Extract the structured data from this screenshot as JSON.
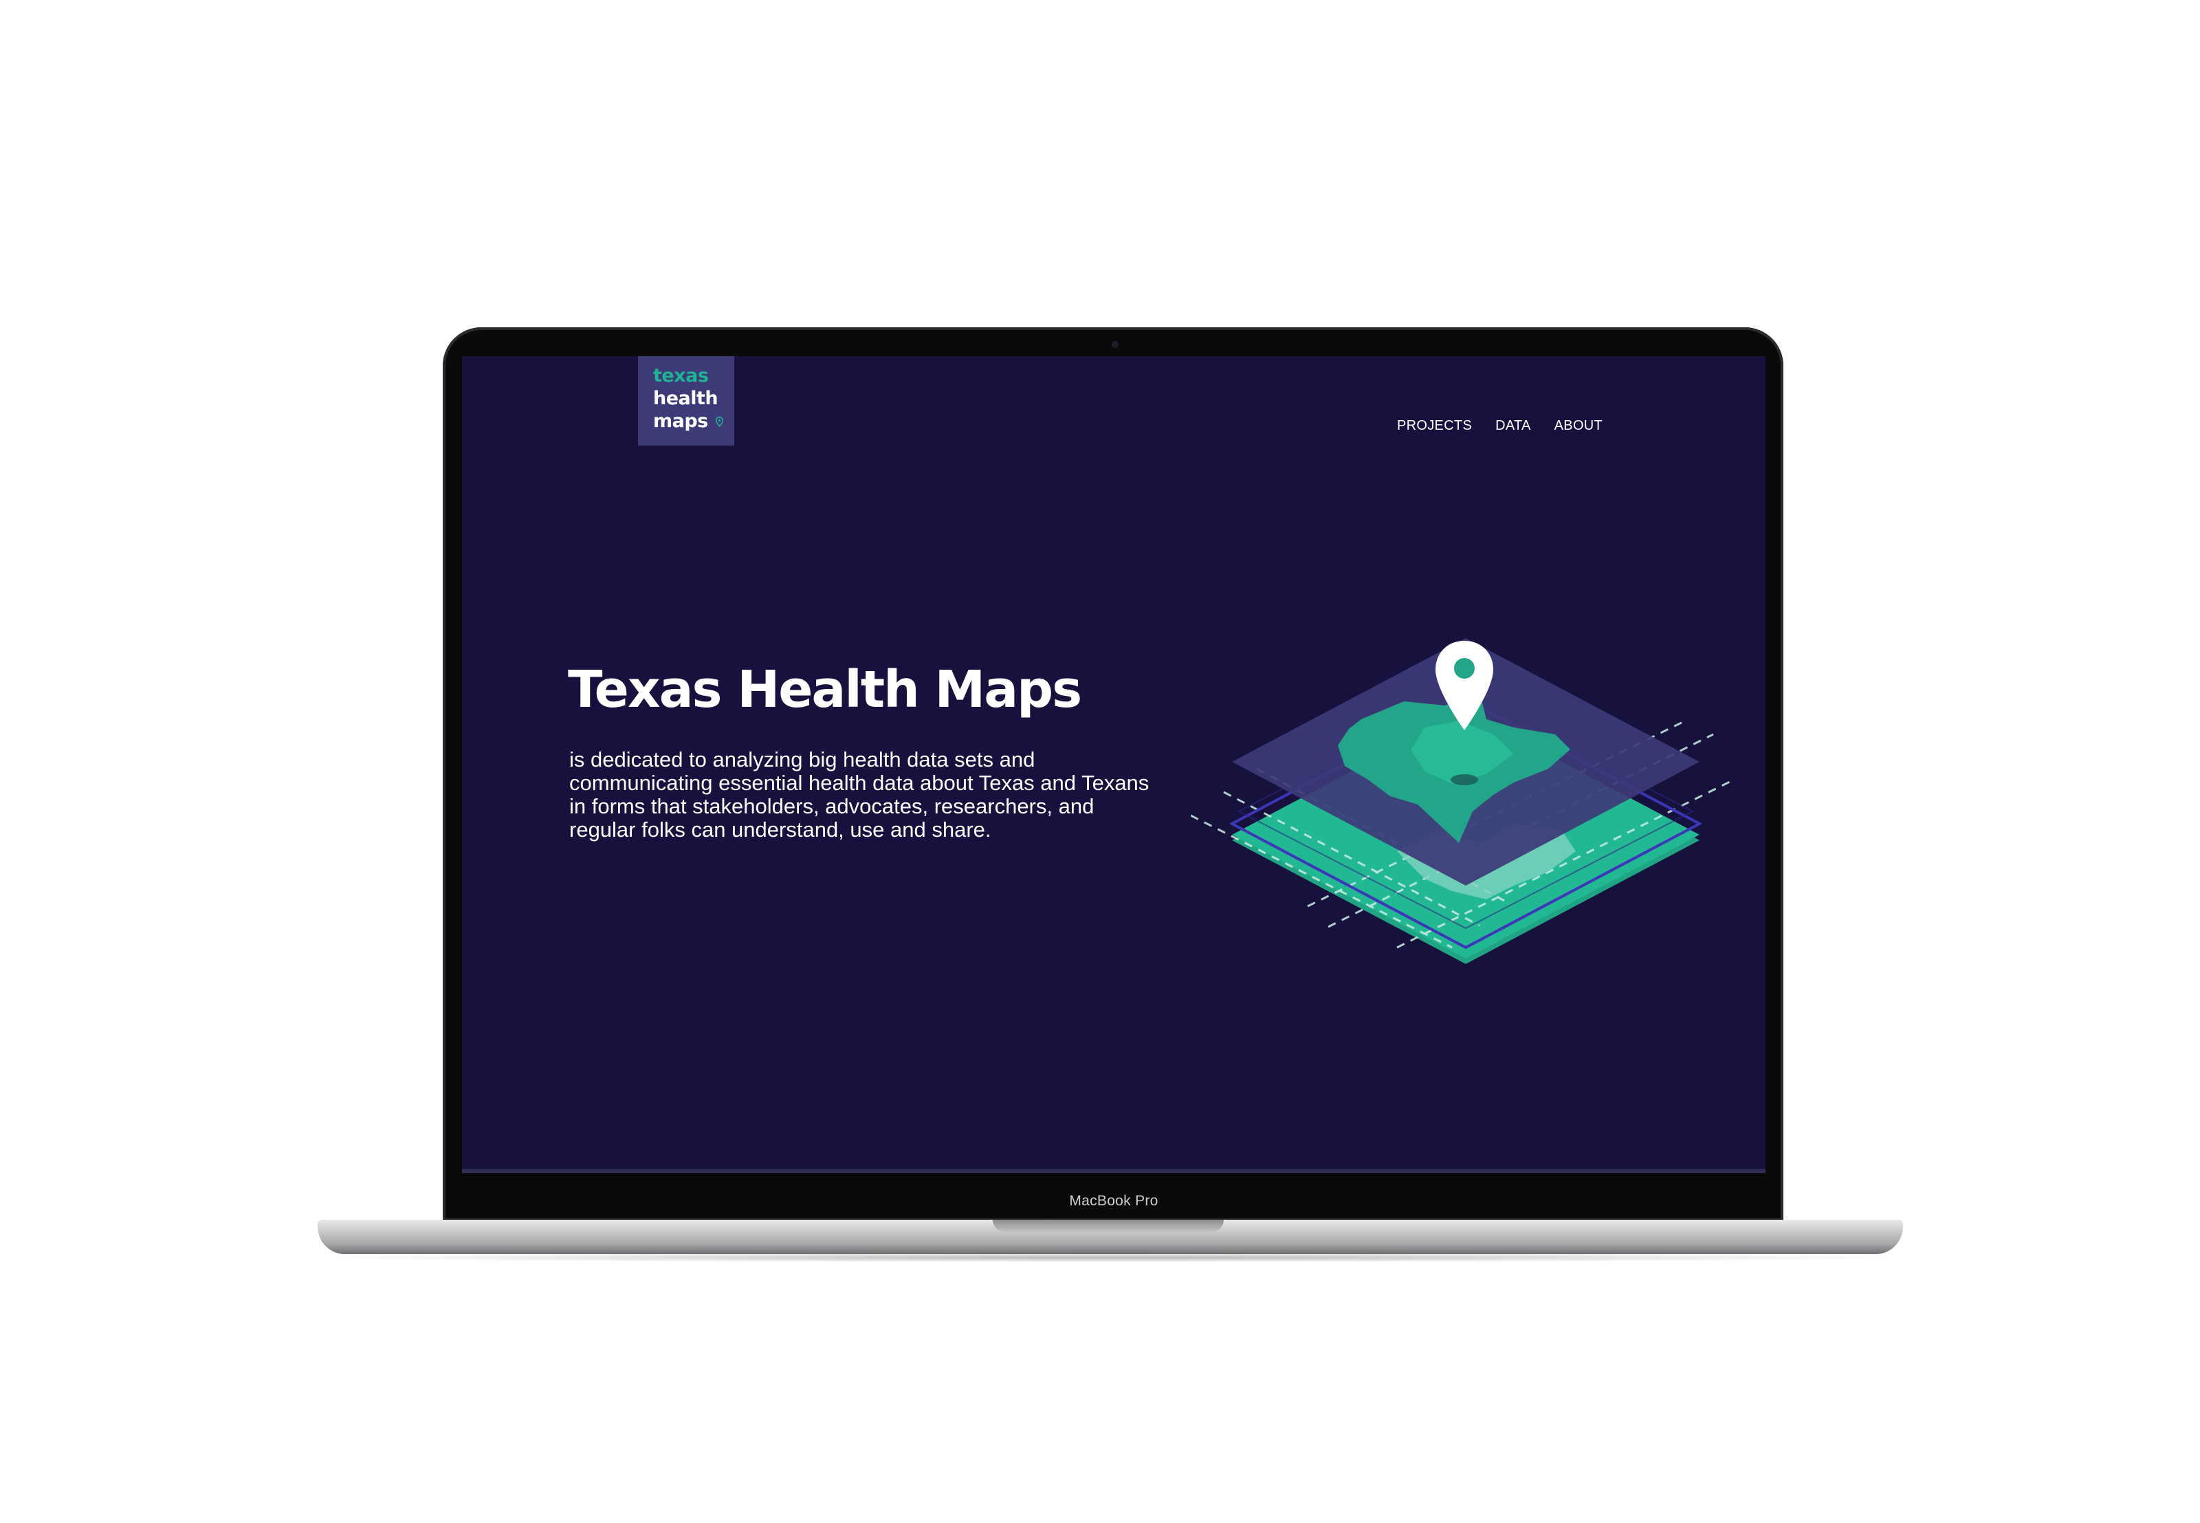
{
  "device": {
    "label": "MacBook Pro"
  },
  "site": {
    "logo": {
      "line1": "texas",
      "line2": "health",
      "line3": "maps",
      "icon": "map-pin-icon"
    },
    "nav": {
      "items": [
        "PROJECTS",
        "DATA",
        "ABOUT"
      ]
    },
    "hero": {
      "title": "Texas Health Maps",
      "description": "is dedicated to analyzing big health data sets and communicating essential health data about Texas and Texans in forms that stakeholders, advocates, researchers, and regular folks can understand, use and share.",
      "illustration_icon": "layered-texas-map-icon"
    }
  },
  "colors": {
    "background": "#16113d",
    "logo_box": "#3d3a78",
    "accent_teal": "#1fb293",
    "text": "#ffffff",
    "layer_purple": "#3d3a78"
  }
}
